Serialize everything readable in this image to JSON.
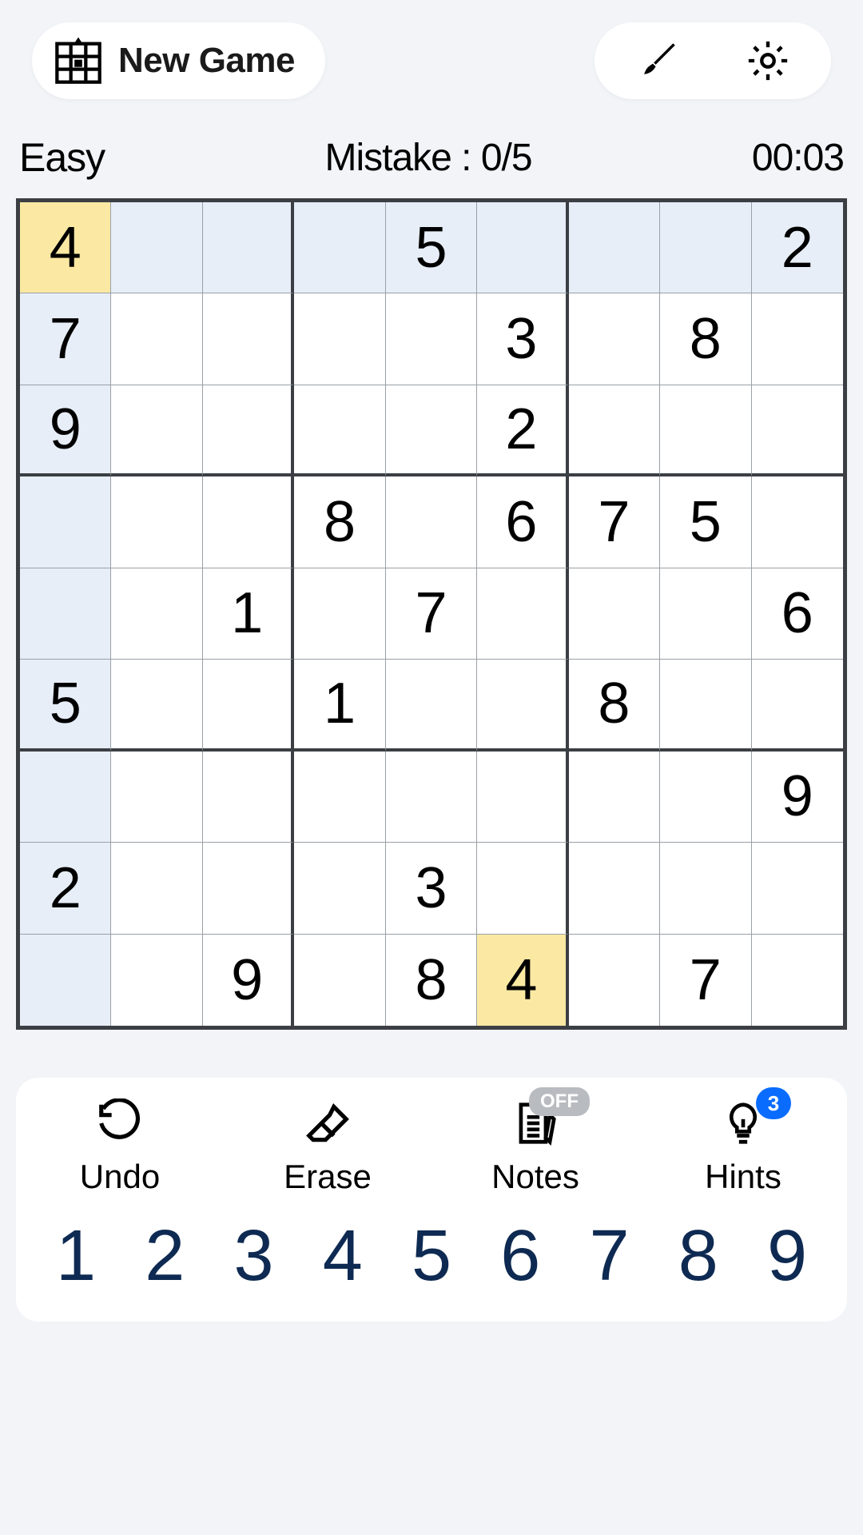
{
  "header": {
    "new_game_label": "New Game"
  },
  "status": {
    "difficulty": "Easy",
    "mistake_label": "Mistake : 0/5",
    "time": "00:03"
  },
  "board": {
    "selected": [
      0,
      0
    ],
    "cells": [
      [
        "4",
        "",
        "",
        "",
        "5",
        "",
        "",
        "",
        "2"
      ],
      [
        "7",
        "",
        "",
        "",
        "",
        "3",
        "",
        "8",
        ""
      ],
      [
        "9",
        "",
        "",
        "",
        "",
        "2",
        "",
        "",
        ""
      ],
      [
        "",
        "",
        "",
        "8",
        "",
        "6",
        "7",
        "5",
        ""
      ],
      [
        "",
        "",
        "1",
        "",
        "7",
        "",
        "",
        "",
        "6"
      ],
      [
        "5",
        "",
        "",
        "1",
        "",
        "",
        "8",
        "",
        ""
      ],
      [
        "",
        "",
        "",
        "",
        "",
        "",
        "",
        "",
        "9"
      ],
      [
        "2",
        "",
        "",
        "",
        "3",
        "",
        "",
        "",
        ""
      ],
      [
        "",
        "",
        "9",
        "",
        "8",
        "4",
        "",
        "7",
        ""
      ]
    ]
  },
  "actions": {
    "undo_label": "Undo",
    "erase_label": "Erase",
    "notes_label": "Notes",
    "notes_state": "OFF",
    "hints_label": "Hints",
    "hints_count": "3"
  },
  "numpad": [
    "1",
    "2",
    "3",
    "4",
    "5",
    "6",
    "7",
    "8",
    "9"
  ]
}
